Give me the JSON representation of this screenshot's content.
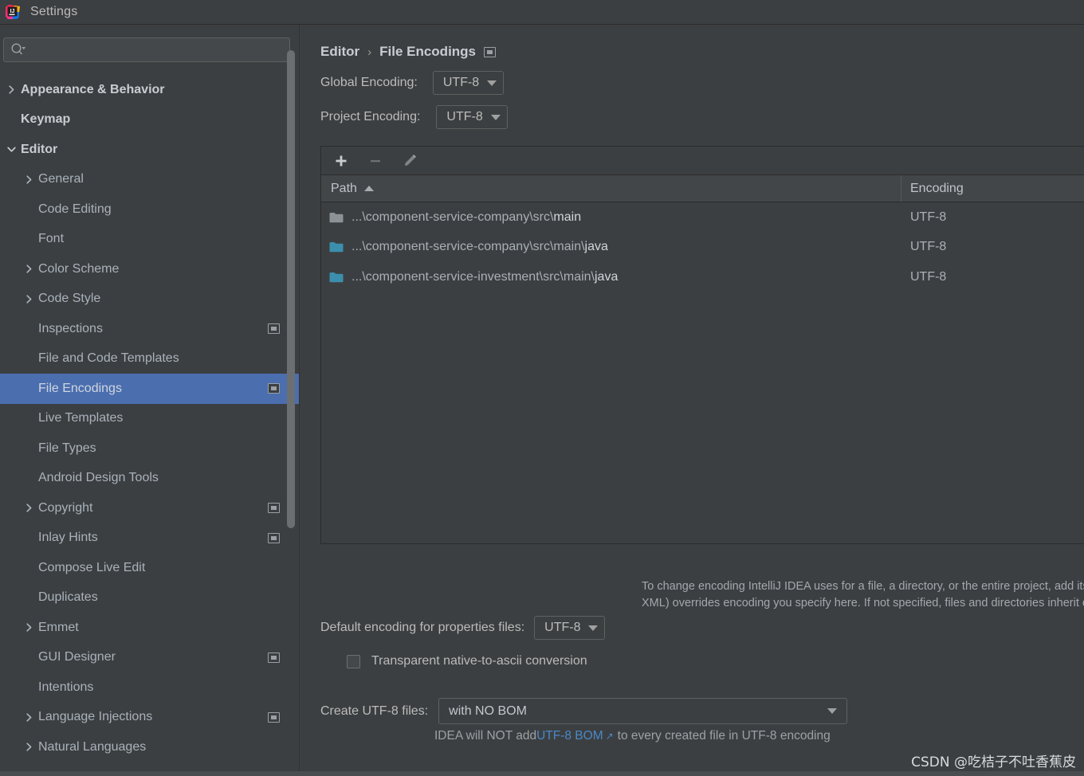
{
  "window": {
    "title": "Settings",
    "logo_icon": "intellij-idea-logo"
  },
  "sidebar": {
    "search": {
      "placeholder": "",
      "value": "",
      "icon": "search-icon",
      "dropdown_icon": "chevron-down-icon"
    },
    "items": [
      {
        "label": "Appearance & Behavior",
        "indent": 0,
        "arrow": "collapsed",
        "bold": true,
        "badge": false,
        "selected": false
      },
      {
        "label": "Keymap",
        "indent": 0,
        "arrow": "none",
        "bold": true,
        "badge": false,
        "selected": false
      },
      {
        "label": "Editor",
        "indent": 0,
        "arrow": "expanded",
        "bold": true,
        "badge": false,
        "selected": false
      },
      {
        "label": "General",
        "indent": 1,
        "arrow": "collapsed",
        "bold": false,
        "badge": false,
        "selected": false
      },
      {
        "label": "Code Editing",
        "indent": 1,
        "arrow": "none",
        "bold": false,
        "badge": false,
        "selected": false
      },
      {
        "label": "Font",
        "indent": 1,
        "arrow": "none",
        "bold": false,
        "badge": false,
        "selected": false
      },
      {
        "label": "Color Scheme",
        "indent": 1,
        "arrow": "collapsed",
        "bold": false,
        "badge": false,
        "selected": false
      },
      {
        "label": "Code Style",
        "indent": 1,
        "arrow": "collapsed",
        "bold": false,
        "badge": false,
        "selected": false
      },
      {
        "label": "Inspections",
        "indent": 1,
        "arrow": "none",
        "bold": false,
        "badge": true,
        "selected": false
      },
      {
        "label": "File and Code Templates",
        "indent": 1,
        "arrow": "none",
        "bold": false,
        "badge": false,
        "selected": false
      },
      {
        "label": "File Encodings",
        "indent": 1,
        "arrow": "none",
        "bold": false,
        "badge": true,
        "selected": true
      },
      {
        "label": "Live Templates",
        "indent": 1,
        "arrow": "none",
        "bold": false,
        "badge": false,
        "selected": false
      },
      {
        "label": "File Types",
        "indent": 1,
        "arrow": "none",
        "bold": false,
        "badge": false,
        "selected": false
      },
      {
        "label": "Android Design Tools",
        "indent": 1,
        "arrow": "none",
        "bold": false,
        "badge": false,
        "selected": false
      },
      {
        "label": "Copyright",
        "indent": 1,
        "arrow": "collapsed",
        "bold": false,
        "badge": true,
        "selected": false
      },
      {
        "label": "Inlay Hints",
        "indent": 1,
        "arrow": "none",
        "bold": false,
        "badge": true,
        "selected": false
      },
      {
        "label": "Compose Live Edit",
        "indent": 1,
        "arrow": "none",
        "bold": false,
        "badge": false,
        "selected": false
      },
      {
        "label": "Duplicates",
        "indent": 1,
        "arrow": "none",
        "bold": false,
        "badge": false,
        "selected": false
      },
      {
        "label": "Emmet",
        "indent": 1,
        "arrow": "collapsed",
        "bold": false,
        "badge": false,
        "selected": false
      },
      {
        "label": "GUI Designer",
        "indent": 1,
        "arrow": "none",
        "bold": false,
        "badge": true,
        "selected": false
      },
      {
        "label": "Intentions",
        "indent": 1,
        "arrow": "none",
        "bold": false,
        "badge": false,
        "selected": false
      },
      {
        "label": "Language Injections",
        "indent": 1,
        "arrow": "collapsed",
        "bold": false,
        "badge": true,
        "selected": false
      },
      {
        "label": "Natural Languages",
        "indent": 1,
        "arrow": "collapsed",
        "bold": false,
        "badge": false,
        "selected": false
      }
    ]
  },
  "main": {
    "breadcrumb": {
      "parent": "Editor",
      "separator": "›",
      "current": "File Encodings",
      "badge_icon": "project-settings-badge-icon"
    },
    "global_encoding": {
      "label": "Global Encoding:",
      "value": "UTF-8"
    },
    "project_encoding": {
      "label": "Project Encoding:",
      "value": "UTF-8"
    },
    "toolbar": {
      "add": "+",
      "remove": "−",
      "edit_icon": "pencil-icon",
      "add_icon": "plus-icon",
      "remove_icon": "minus-icon"
    },
    "table": {
      "columns": [
        "Path",
        "Encoding"
      ],
      "sort_column": "Path",
      "sort_direction": "ascending",
      "rows": [
        {
          "path_head": "...\\component-service-company\\src\\",
          "path_tail": "main",
          "encoding": "UTF-8",
          "folder_color": "#8d9297"
        },
        {
          "path_head": "...\\component-service-company\\src\\main\\",
          "path_tail": "java",
          "encoding": "UTF-8",
          "folder_color": "#3b8fad"
        },
        {
          "path_head": "...\\component-service-investment\\src\\main\\",
          "path_tail": "java",
          "encoding": "UTF-8",
          "folder_color": "#3b8fad"
        }
      ]
    },
    "description_line1": "To change encoding IntelliJ IDEA uses for a file, a directory, or the entire project, add its path if necessary and then select",
    "description_line2": "XML) overrides encoding you specify here. If not specified, files and directories inherit encoding settings from the parent",
    "properties_encoding": {
      "label": "Default encoding for properties files:",
      "value": "UTF-8"
    },
    "transparent_ascii": {
      "label": "Transparent native-to-ascii conversion",
      "checked": false
    },
    "create_utf8": {
      "label": "Create UTF-8 files:",
      "value": "with NO BOM"
    },
    "bom_hint": {
      "prefix": "IDEA will NOT add ",
      "link": "UTF-8 BOM",
      "link_arrow": "↗",
      "suffix": "to every created file in UTF-8 encoding"
    }
  },
  "watermark": "CSDN @吃桔子不吐香蕉皮",
  "colors": {
    "background": "#3c3f41",
    "selection": "#4b6eaf",
    "text": "#bbbbbb",
    "link": "#4a88c7",
    "folder_teal": "#3b8fad",
    "folder_gray": "#8d9297"
  }
}
